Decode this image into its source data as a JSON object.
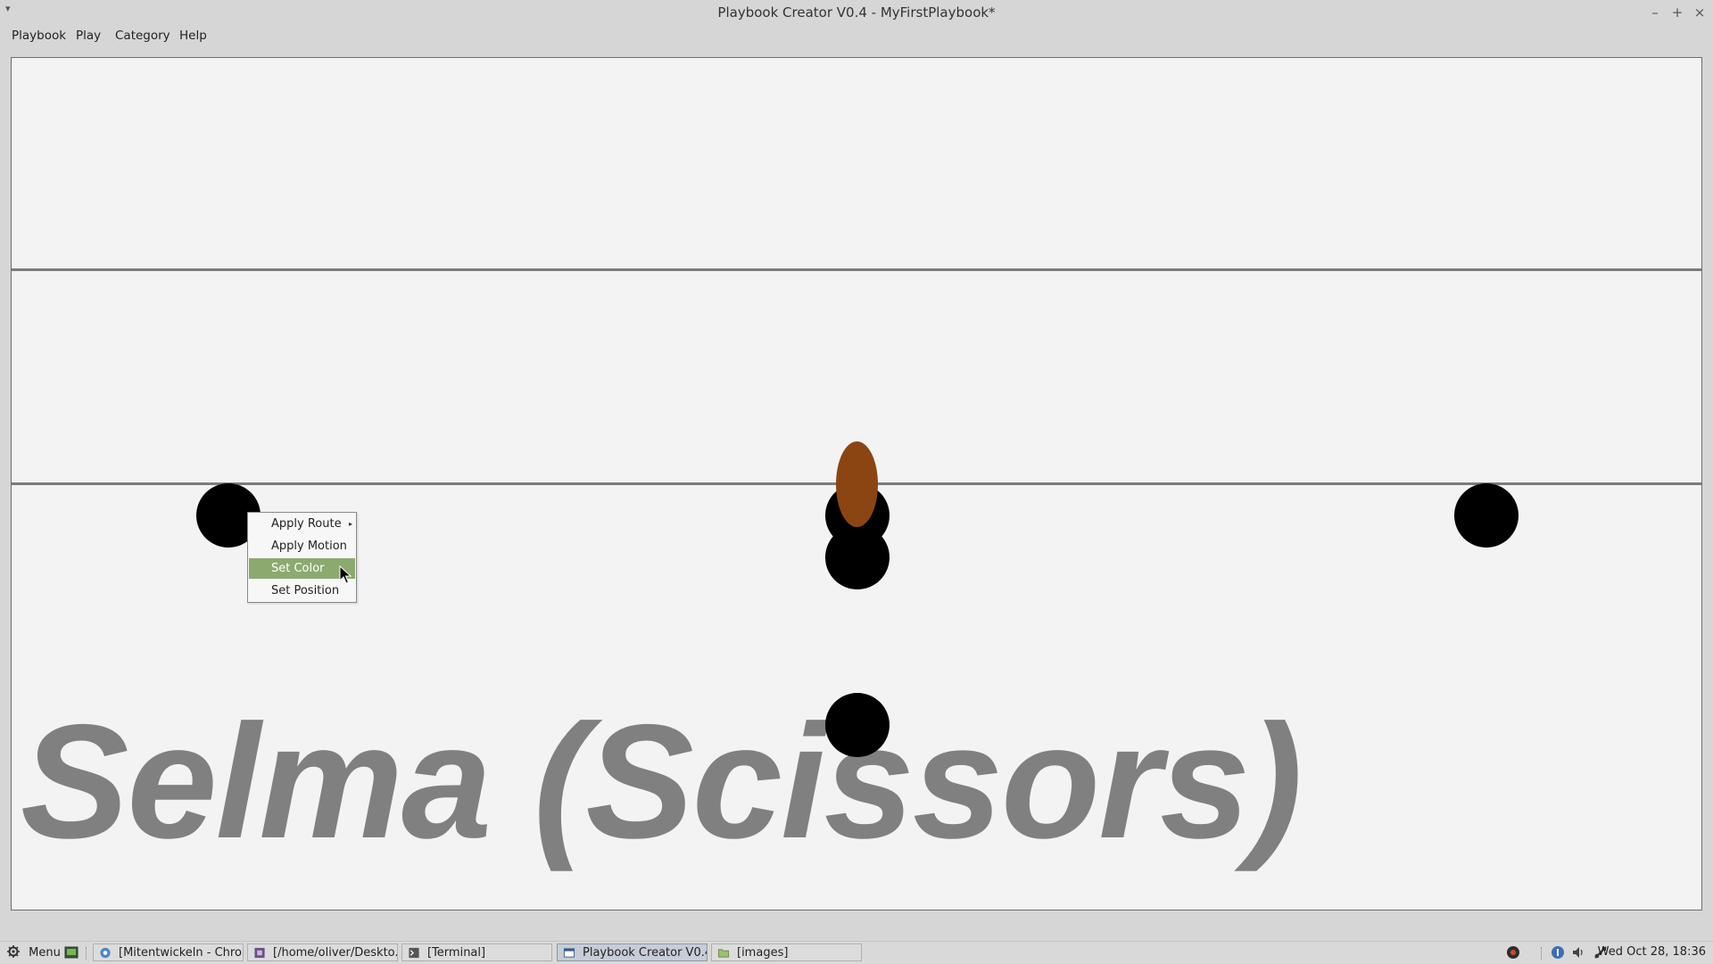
{
  "window": {
    "title": "Playbook Creator V0.4 - MyFirstPlaybook*",
    "wm_menu_glyph": "▾",
    "minimize_glyph": "–",
    "maximize_glyph": "+",
    "close_glyph": "×"
  },
  "menubar": {
    "items": [
      {
        "label": "Playbook"
      },
      {
        "label": "Play"
      },
      {
        "label": "Category"
      },
      {
        "label": "Help"
      }
    ]
  },
  "field": {
    "play_name": "Selma (Scissors)",
    "player_color": "#000000",
    "ball_color": "#8b4513"
  },
  "context_menu": {
    "items": [
      {
        "label": "Apply Route",
        "has_submenu": true,
        "arrow": "▸"
      },
      {
        "label": "Apply Motion",
        "has_submenu": false
      },
      {
        "label": "Set Color",
        "has_submenu": false,
        "highlighted": true
      },
      {
        "label": "Set Position",
        "has_submenu": false
      }
    ],
    "highlight_color": "#8caa6f"
  },
  "taskbar": {
    "menu_label": "Menu",
    "tasks": [
      {
        "label": "[Mitentwickeln - Chro...",
        "icon": "chrome-icon"
      },
      {
        "label": "[/home/oliver/Deskto...",
        "icon": "editor-icon"
      },
      {
        "label": "[Terminal]",
        "icon": "terminal-icon"
      },
      {
        "label": "Playbook Creator V0.4...",
        "icon": "window-icon",
        "active": true
      },
      {
        "label": "[images]",
        "icon": "folder-icon"
      }
    ],
    "clock": "Wed Oct 28, 18:36"
  }
}
